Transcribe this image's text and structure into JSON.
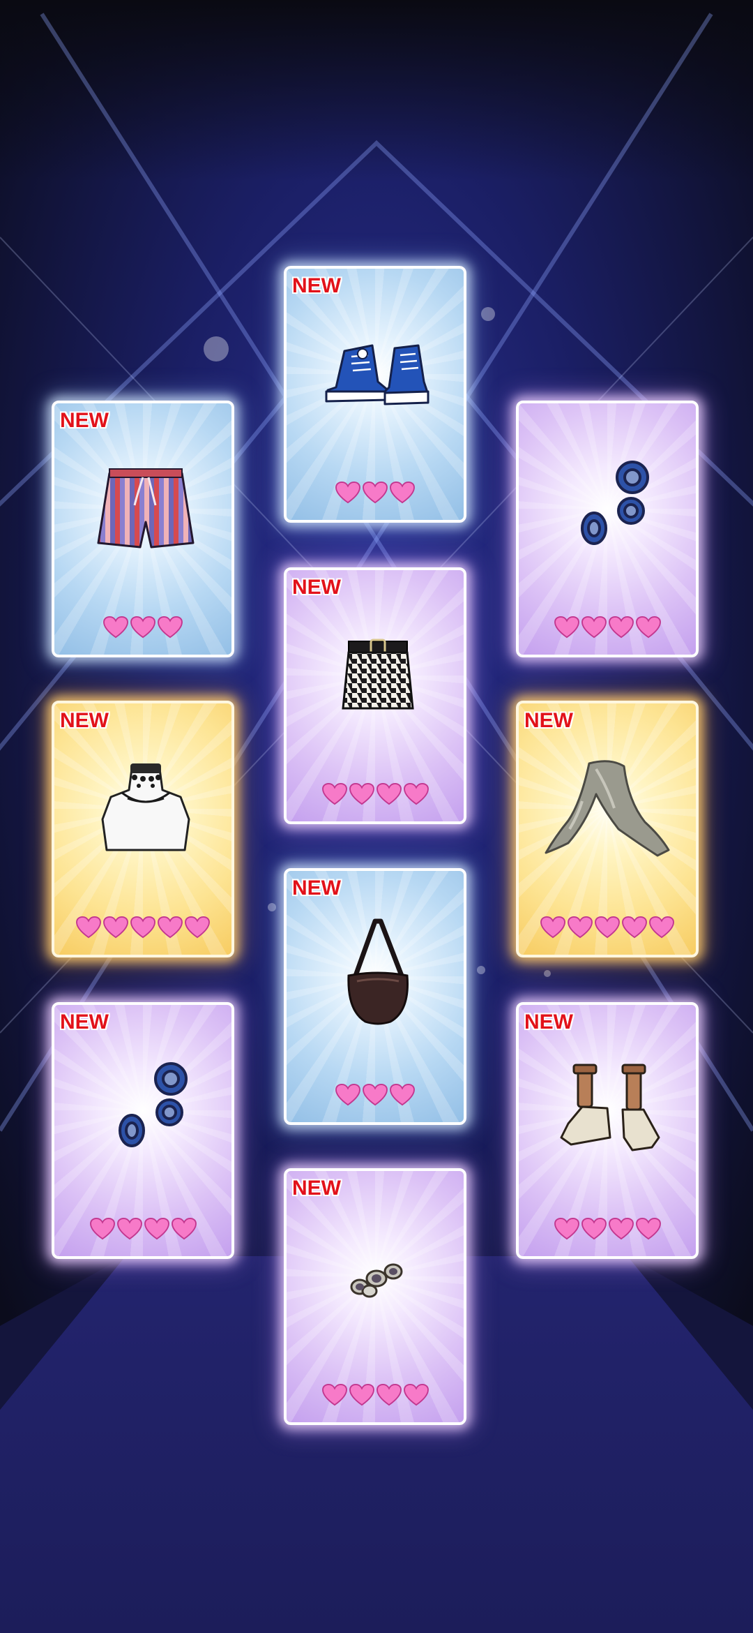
{
  "cards": [
    {
      "id": "top-sneakers",
      "new_label": "NEW",
      "item": "blue-high-top-sneakers",
      "rarity": "blue",
      "hearts": 3
    },
    {
      "id": "striped-shorts",
      "new_label": "NEW",
      "item": "striped-shorts",
      "rarity": "blue",
      "hearts": 3
    },
    {
      "id": "blue-earrings-right",
      "new_label": "",
      "item": "blue-hoop-earrings",
      "rarity": "purple",
      "hearts": 4
    },
    {
      "id": "houndstooth-skirt",
      "new_label": "NEW",
      "item": "houndstooth-skirt",
      "rarity": "purple",
      "hearts": 4
    },
    {
      "id": "lace-choker-top",
      "new_label": "NEW",
      "item": "lace-choker-top",
      "rarity": "gold",
      "hearts": 5
    },
    {
      "id": "silver-scarf",
      "new_label": "NEW",
      "item": "silver-scarf",
      "rarity": "gold",
      "hearts": 5
    },
    {
      "id": "leather-bag",
      "new_label": "NEW",
      "item": "leather-crossbody-bag",
      "rarity": "blue",
      "hearts": 3
    },
    {
      "id": "blue-earrings-left",
      "new_label": "NEW",
      "item": "blue-hoop-earrings",
      "rarity": "purple",
      "hearts": 4
    },
    {
      "id": "platform-sandals",
      "new_label": "NEW",
      "item": "platform-sandals",
      "rarity": "purple",
      "hearts": 4
    },
    {
      "id": "jewel-bracelet",
      "new_label": "NEW",
      "item": "jewel-bracelet",
      "rarity": "purple",
      "hearts": 4
    }
  ],
  "colors": {
    "heart": "#f77ac8",
    "heart_outline": "#c2378f",
    "new_badge": "#e2121a",
    "background_dark": "#0b0c18",
    "background_glow": "#3a3fb0"
  }
}
